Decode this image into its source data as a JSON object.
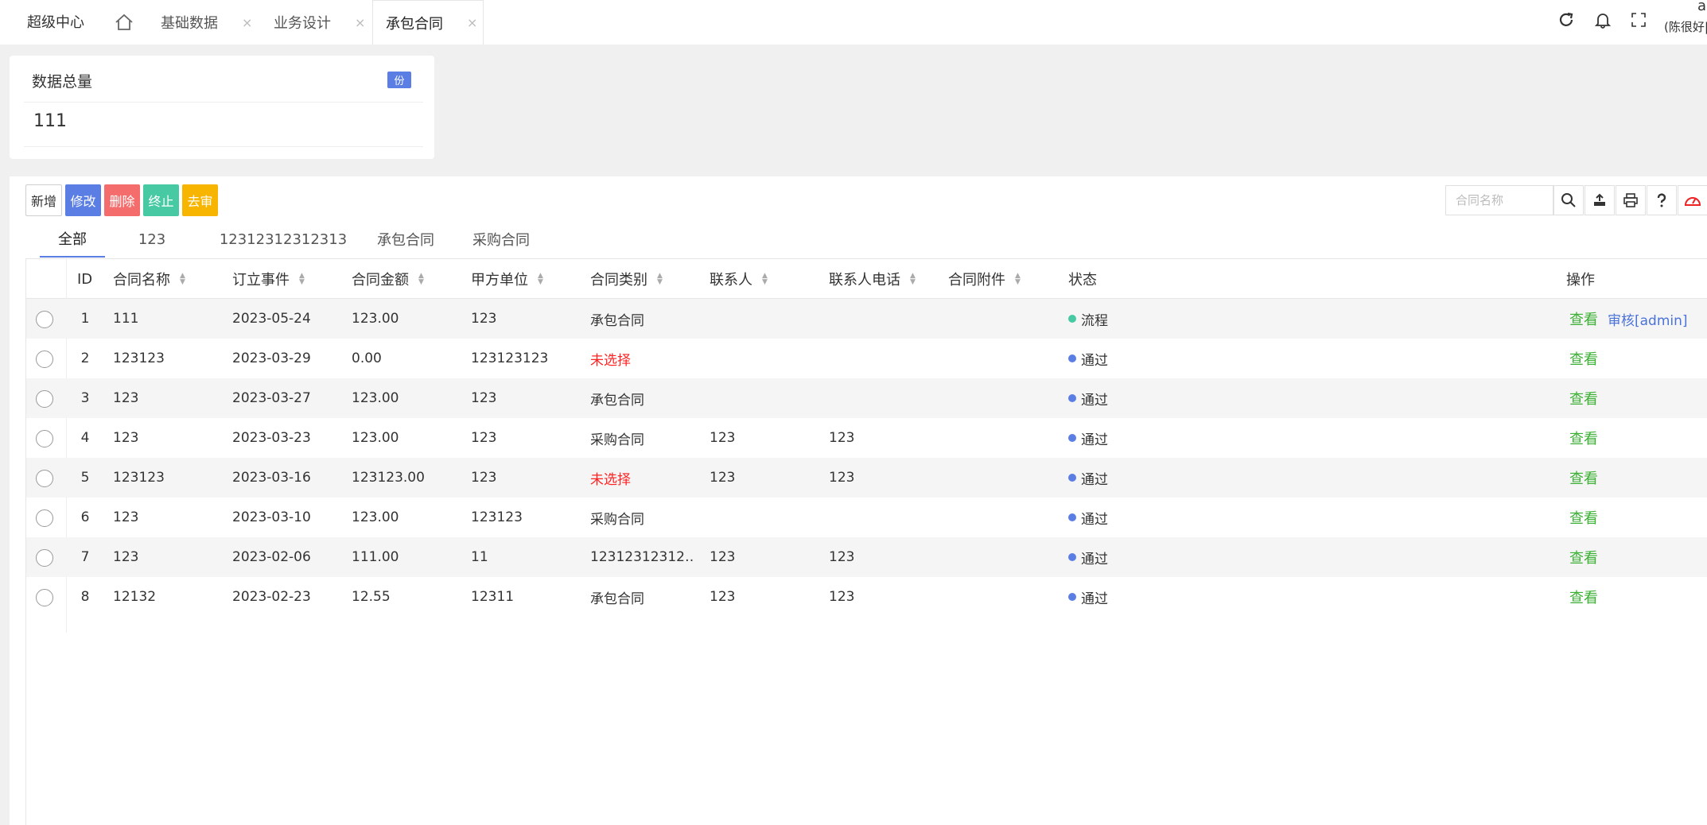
{
  "header": {
    "brand": "超级中心",
    "tabs": [
      {
        "label": "基础数据",
        "close": "×"
      },
      {
        "label": "业务设计",
        "close": "×"
      },
      {
        "label": "承包合同",
        "close": "×"
      }
    ],
    "user_line1": "ac",
    "user_line2": "(陈很好|"
  },
  "stat": {
    "title": "数据总量",
    "badge": "份",
    "value": "111"
  },
  "toolbar": {
    "add": "新增",
    "edit": "修改",
    "delete": "删除",
    "stop": "终止",
    "review": "去审",
    "search_placeholder": "合同名称"
  },
  "subtabs": [
    "全部",
    "123",
    "12312312312313",
    "承包合同",
    "采购合同"
  ],
  "table": {
    "columns": [
      "ID",
      "合同名称",
      "订立事件",
      "合同金额",
      "甲方单位",
      "合同类别",
      "联系人",
      "联系人电话",
      "合同附件",
      "状态",
      "操作"
    ],
    "rows": [
      {
        "id": "1",
        "name": "111",
        "date": "2023-05-24",
        "amount": "123.00",
        "party": "123",
        "type": "承包合同",
        "type_red": false,
        "contact": "",
        "phone": "",
        "attach": "",
        "status": "流程",
        "status_color": "#47c9a3",
        "view": "查看",
        "audit": "审核[admin]"
      },
      {
        "id": "2",
        "name": "123123",
        "date": "2023-03-29",
        "amount": "0.00",
        "party": "123123123",
        "type": "未选择",
        "type_red": true,
        "contact": "",
        "phone": "",
        "attach": "",
        "status": "通过",
        "status_color": "#5b7ee5",
        "view": "查看",
        "audit": ""
      },
      {
        "id": "3",
        "name": "123",
        "date": "2023-03-27",
        "amount": "123.00",
        "party": "123",
        "type": "承包合同",
        "type_red": false,
        "contact": "",
        "phone": "",
        "attach": "",
        "status": "通过",
        "status_color": "#5b7ee5",
        "view": "查看",
        "audit": ""
      },
      {
        "id": "4",
        "name": "123",
        "date": "2023-03-23",
        "amount": "123.00",
        "party": "123",
        "type": "采购合同",
        "type_red": false,
        "contact": "123",
        "phone": "123",
        "attach": "",
        "status": "通过",
        "status_color": "#5b7ee5",
        "view": "查看",
        "audit": ""
      },
      {
        "id": "5",
        "name": "123123",
        "date": "2023-03-16",
        "amount": "123123.00",
        "party": "123",
        "type": "未选择",
        "type_red": true,
        "contact": "123",
        "phone": "123",
        "attach": "",
        "status": "通过",
        "status_color": "#5b7ee5",
        "view": "查看",
        "audit": ""
      },
      {
        "id": "6",
        "name": "123",
        "date": "2023-03-10",
        "amount": "123.00",
        "party": "123123",
        "type": "采购合同",
        "type_red": false,
        "contact": "",
        "phone": "",
        "attach": "",
        "status": "通过",
        "status_color": "#5b7ee5",
        "view": "查看",
        "audit": ""
      },
      {
        "id": "7",
        "name": "123",
        "date": "2023-02-06",
        "amount": "111.00",
        "party": "11",
        "type": "12312312312…",
        "type_red": false,
        "contact": "123",
        "phone": "123",
        "attach": "",
        "status": "通过",
        "status_color": "#5b7ee5",
        "view": "查看",
        "audit": ""
      },
      {
        "id": "8",
        "name": "12132",
        "date": "2023-02-23",
        "amount": "12.55",
        "party": "12311",
        "type": "承包合同",
        "type_red": false,
        "contact": "123",
        "phone": "123",
        "attach": "",
        "status": "通过",
        "status_color": "#5b7ee5",
        "view": "查看",
        "audit": ""
      }
    ]
  }
}
